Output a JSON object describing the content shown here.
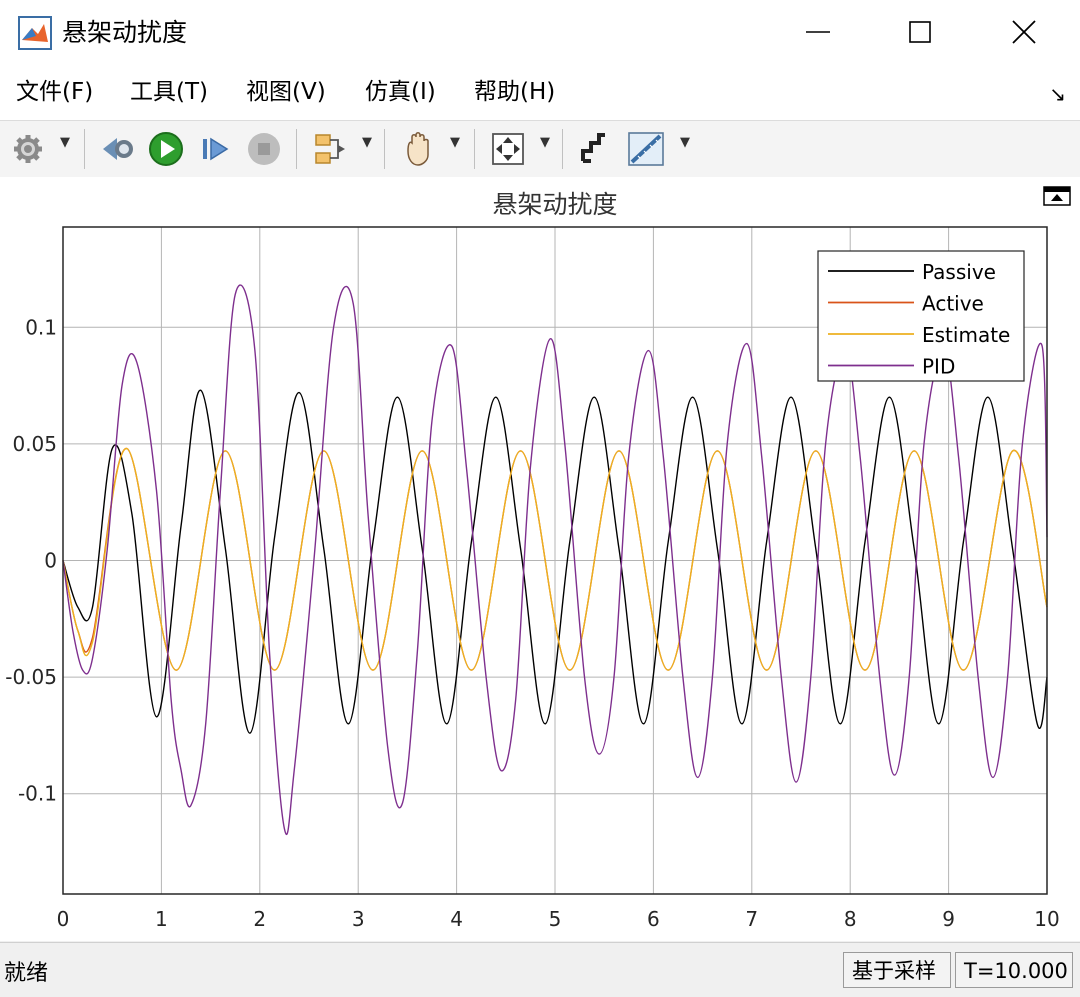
{
  "window": {
    "title": "悬架动扰度"
  },
  "menu": {
    "items": [
      "文件(F)",
      "工具(T)",
      "视图(V)",
      "仿真(I)",
      "帮助(H)"
    ]
  },
  "toolbar": {
    "icons": [
      "gear-icon",
      "step-back-icon",
      "run-icon",
      "step-forward-icon",
      "stop-icon",
      "signal-select-icon",
      "pan-icon",
      "zoom-fit-icon",
      "cursor-icon",
      "measure-icon"
    ]
  },
  "status": {
    "left": "就绪",
    "mode": "基于采样",
    "time": "T=10.000"
  },
  "colors": {
    "passive": "#000000",
    "active": "#d95319",
    "estimate": "#edb120",
    "pid": "#7e2f8e",
    "run": "#2e9e2e"
  },
  "chart_data": {
    "type": "line",
    "title": "悬架动扰度",
    "xlabel": "",
    "ylabel": "",
    "xlim": [
      0,
      10
    ],
    "ylim": [
      -0.143,
      0.143
    ],
    "xticks": [
      "0",
      "1",
      "2",
      "3",
      "4",
      "5",
      "6",
      "7",
      "8",
      "9",
      "10"
    ],
    "yticks": [
      "0.1",
      "0.05",
      "0",
      "-0.05",
      "-0.1"
    ],
    "grid": true,
    "legend_position": "top-right",
    "series": [
      {
        "name": "Passive",
        "x": [
          0,
          0.15,
          0.3,
          0.5,
          0.7,
          0.95,
          1.2,
          1.4,
          1.65,
          1.9,
          2.15,
          2.4,
          2.65,
          2.9,
          3.15,
          3.4,
          3.65,
          3.9,
          4.15,
          4.4,
          4.65,
          4.9,
          5.15,
          5.4,
          5.65,
          5.9,
          6.15,
          6.4,
          6.65,
          6.9,
          7.15,
          7.4,
          7.65,
          7.9,
          8.15,
          8.4,
          8.65,
          8.9,
          9.15,
          9.4,
          9.65,
          9.9,
          10
        ],
        "values": [
          0,
          -0.02,
          -0.02,
          0.048,
          0.02,
          -0.067,
          0.015,
          0.073,
          0.005,
          -0.074,
          0.01,
          0.072,
          0.005,
          -0.07,
          0.008,
          0.07,
          0.005,
          -0.07,
          0.008,
          0.07,
          0.005,
          -0.07,
          0.008,
          0.07,
          0.005,
          -0.07,
          0.008,
          0.07,
          0.005,
          -0.07,
          0.008,
          0.07,
          0.005,
          -0.07,
          0.008,
          0.07,
          0.005,
          -0.07,
          0.008,
          0.07,
          0.005,
          -0.07,
          -0.05
        ]
      },
      {
        "name": "Active",
        "x": [
          0,
          0.15,
          0.3,
          0.65,
          1.15,
          1.65,
          2.15,
          2.65,
          3.15,
          3.65,
          4.15,
          4.65,
          5.15,
          5.65,
          6.15,
          6.65,
          7.15,
          7.65,
          8.15,
          8.65,
          9.15,
          9.65,
          10
        ],
        "values": [
          0,
          -0.03,
          -0.033,
          0.048,
          -0.047,
          0.047,
          -0.047,
          0.047,
          -0.047,
          0.047,
          -0.047,
          0.047,
          -0.047,
          0.047,
          -0.047,
          0.047,
          -0.047,
          0.047,
          -0.047,
          0.047,
          -0.047,
          0.047,
          -0.02
        ]
      },
      {
        "name": "Estimate",
        "x": [
          0,
          0.15,
          0.3,
          0.65,
          1.15,
          1.65,
          2.15,
          2.65,
          3.15,
          3.65,
          4.15,
          4.65,
          5.15,
          5.65,
          6.15,
          6.65,
          7.15,
          7.65,
          8.15,
          8.65,
          9.15,
          9.65,
          10
        ],
        "values": [
          0,
          -0.03,
          -0.035,
          0.048,
          -0.047,
          0.047,
          -0.047,
          0.047,
          -0.047,
          0.047,
          -0.047,
          0.047,
          -0.047,
          0.047,
          -0.047,
          0.047,
          -0.047,
          0.047,
          -0.047,
          0.047,
          -0.047,
          0.047,
          -0.02
        ]
      },
      {
        "name": "PID",
        "x": [
          0,
          0.1,
          0.2,
          0.3,
          0.45,
          0.6,
          0.75,
          0.95,
          1.1,
          1.2,
          1.3,
          1.45,
          1.6,
          1.75,
          1.95,
          2.1,
          2.25,
          2.35,
          2.55,
          2.75,
          2.95,
          3.1,
          3.3,
          3.45,
          3.6,
          3.75,
          3.95,
          4.1,
          4.3,
          4.45,
          4.6,
          4.75,
          4.95,
          5.1,
          5.3,
          5.45,
          5.6,
          5.75,
          5.95,
          6.1,
          6.3,
          6.45,
          6.6,
          6.75,
          6.95,
          7.1,
          7.3,
          7.45,
          7.6,
          7.75,
          7.95,
          8.1,
          8.3,
          8.45,
          8.6,
          8.75,
          8.95,
          9.1,
          9.3,
          9.45,
          9.6,
          9.75,
          9.95,
          10
        ],
        "values": [
          0,
          -0.03,
          -0.047,
          -0.042,
          0.005,
          0.075,
          0.085,
          0.03,
          -0.06,
          -0.09,
          -0.105,
          -0.07,
          0.03,
          0.114,
          0.09,
          -0.04,
          -0.115,
          -0.09,
          0.0,
          0.1,
          0.11,
          0.02,
          -0.08,
          -0.104,
          -0.04,
          0.06,
          0.092,
          0.04,
          -0.05,
          -0.09,
          -0.06,
          0.04,
          0.095,
          0.05,
          -0.05,
          -0.083,
          -0.05,
          0.045,
          0.09,
          0.045,
          -0.05,
          -0.093,
          -0.05,
          0.05,
          0.093,
          0.045,
          -0.05,
          -0.095,
          -0.05,
          0.05,
          0.09,
          0.045,
          -0.05,
          -0.092,
          -0.05,
          0.05,
          0.09,
          0.045,
          -0.05,
          -0.093,
          -0.05,
          0.05,
          0.092,
          0.01
        ]
      }
    ]
  }
}
